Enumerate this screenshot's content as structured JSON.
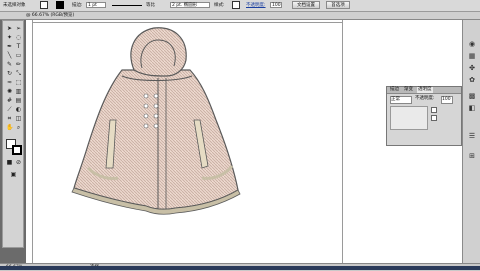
{
  "control_bar": {
    "selection_label": "未选择对象",
    "stroke_label": "描边:",
    "stroke_weight": "1 pt",
    "stroke_style_label": "等比",
    "brush_label": "2 pt. 椭圆形",
    "style_label": "样式:",
    "opacity_label": "不透明度:",
    "opacity_value": "100",
    "doc_setup_button": "文档设置",
    "preferences_button": "首选项"
  },
  "sub_bar": {
    "tab_label": "@ 66.67% (RGB/预览)"
  },
  "transparency_panel": {
    "tabs": [
      "描边",
      "渐变",
      "透明度"
    ],
    "active_tab": "透明度",
    "blend_mode": "正常",
    "opacity_label": "不透明度:",
    "opacity_value": "100"
  },
  "status_bar": {
    "zoom": "66.67%",
    "tool_name": "选择"
  },
  "colors": {
    "fabric_base": "#f0dcd2",
    "fabric_pattern": "#c9b0a4",
    "outline": "#5a5a5a",
    "trim": "#c8bfa6"
  },
  "icons": [
    "selection-tool-icon",
    "direct-select-tool-icon",
    "magic-wand-icon",
    "lasso-icon",
    "pen-tool-icon",
    "type-tool-icon",
    "line-tool-icon",
    "rectangle-tool-icon",
    "brush-tool-icon",
    "pencil-tool-icon",
    "rotate-tool-icon",
    "scale-tool-icon",
    "warp-tool-icon",
    "free-transform-icon",
    "symbol-sprayer-icon",
    "graph-tool-icon",
    "mesh-tool-icon",
    "gradient-tool-icon",
    "eyedropper-tool-icon",
    "blend-tool-icon",
    "slice-tool-icon",
    "eraser-tool-icon",
    "hand-tool-icon",
    "zoom-tool-icon"
  ]
}
